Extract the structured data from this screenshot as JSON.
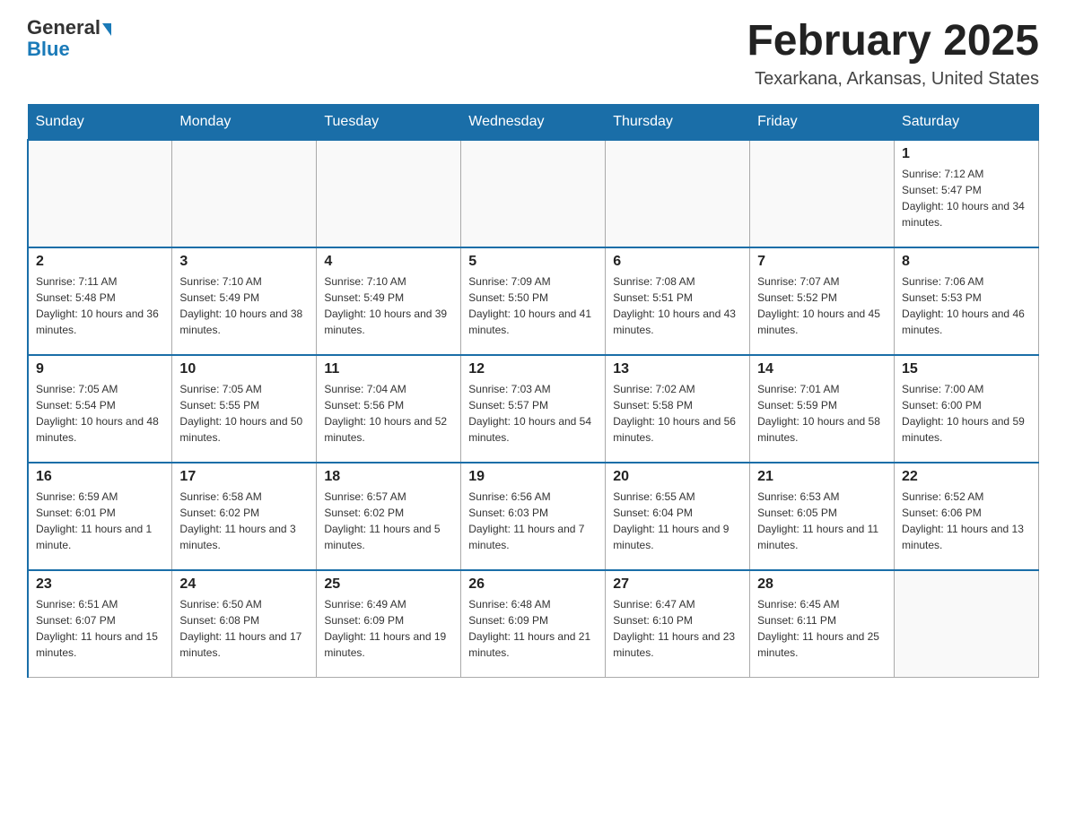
{
  "header": {
    "logo_general": "General",
    "logo_blue": "Blue",
    "month_title": "February 2025",
    "location": "Texarkana, Arkansas, United States"
  },
  "days_of_week": [
    "Sunday",
    "Monday",
    "Tuesday",
    "Wednesday",
    "Thursday",
    "Friday",
    "Saturday"
  ],
  "weeks": [
    [
      {
        "day": "",
        "info": ""
      },
      {
        "day": "",
        "info": ""
      },
      {
        "day": "",
        "info": ""
      },
      {
        "day": "",
        "info": ""
      },
      {
        "day": "",
        "info": ""
      },
      {
        "day": "",
        "info": ""
      },
      {
        "day": "1",
        "info": "Sunrise: 7:12 AM\nSunset: 5:47 PM\nDaylight: 10 hours and 34 minutes."
      }
    ],
    [
      {
        "day": "2",
        "info": "Sunrise: 7:11 AM\nSunset: 5:48 PM\nDaylight: 10 hours and 36 minutes."
      },
      {
        "day": "3",
        "info": "Sunrise: 7:10 AM\nSunset: 5:49 PM\nDaylight: 10 hours and 38 minutes."
      },
      {
        "day": "4",
        "info": "Sunrise: 7:10 AM\nSunset: 5:49 PM\nDaylight: 10 hours and 39 minutes."
      },
      {
        "day": "5",
        "info": "Sunrise: 7:09 AM\nSunset: 5:50 PM\nDaylight: 10 hours and 41 minutes."
      },
      {
        "day": "6",
        "info": "Sunrise: 7:08 AM\nSunset: 5:51 PM\nDaylight: 10 hours and 43 minutes."
      },
      {
        "day": "7",
        "info": "Sunrise: 7:07 AM\nSunset: 5:52 PM\nDaylight: 10 hours and 45 minutes."
      },
      {
        "day": "8",
        "info": "Sunrise: 7:06 AM\nSunset: 5:53 PM\nDaylight: 10 hours and 46 minutes."
      }
    ],
    [
      {
        "day": "9",
        "info": "Sunrise: 7:05 AM\nSunset: 5:54 PM\nDaylight: 10 hours and 48 minutes."
      },
      {
        "day": "10",
        "info": "Sunrise: 7:05 AM\nSunset: 5:55 PM\nDaylight: 10 hours and 50 minutes."
      },
      {
        "day": "11",
        "info": "Sunrise: 7:04 AM\nSunset: 5:56 PM\nDaylight: 10 hours and 52 minutes."
      },
      {
        "day": "12",
        "info": "Sunrise: 7:03 AM\nSunset: 5:57 PM\nDaylight: 10 hours and 54 minutes."
      },
      {
        "day": "13",
        "info": "Sunrise: 7:02 AM\nSunset: 5:58 PM\nDaylight: 10 hours and 56 minutes."
      },
      {
        "day": "14",
        "info": "Sunrise: 7:01 AM\nSunset: 5:59 PM\nDaylight: 10 hours and 58 minutes."
      },
      {
        "day": "15",
        "info": "Sunrise: 7:00 AM\nSunset: 6:00 PM\nDaylight: 10 hours and 59 minutes."
      }
    ],
    [
      {
        "day": "16",
        "info": "Sunrise: 6:59 AM\nSunset: 6:01 PM\nDaylight: 11 hours and 1 minute."
      },
      {
        "day": "17",
        "info": "Sunrise: 6:58 AM\nSunset: 6:02 PM\nDaylight: 11 hours and 3 minutes."
      },
      {
        "day": "18",
        "info": "Sunrise: 6:57 AM\nSunset: 6:02 PM\nDaylight: 11 hours and 5 minutes."
      },
      {
        "day": "19",
        "info": "Sunrise: 6:56 AM\nSunset: 6:03 PM\nDaylight: 11 hours and 7 minutes."
      },
      {
        "day": "20",
        "info": "Sunrise: 6:55 AM\nSunset: 6:04 PM\nDaylight: 11 hours and 9 minutes."
      },
      {
        "day": "21",
        "info": "Sunrise: 6:53 AM\nSunset: 6:05 PM\nDaylight: 11 hours and 11 minutes."
      },
      {
        "day": "22",
        "info": "Sunrise: 6:52 AM\nSunset: 6:06 PM\nDaylight: 11 hours and 13 minutes."
      }
    ],
    [
      {
        "day": "23",
        "info": "Sunrise: 6:51 AM\nSunset: 6:07 PM\nDaylight: 11 hours and 15 minutes."
      },
      {
        "day": "24",
        "info": "Sunrise: 6:50 AM\nSunset: 6:08 PM\nDaylight: 11 hours and 17 minutes."
      },
      {
        "day": "25",
        "info": "Sunrise: 6:49 AM\nSunset: 6:09 PM\nDaylight: 11 hours and 19 minutes."
      },
      {
        "day": "26",
        "info": "Sunrise: 6:48 AM\nSunset: 6:09 PM\nDaylight: 11 hours and 21 minutes."
      },
      {
        "day": "27",
        "info": "Sunrise: 6:47 AM\nSunset: 6:10 PM\nDaylight: 11 hours and 23 minutes."
      },
      {
        "day": "28",
        "info": "Sunrise: 6:45 AM\nSunset: 6:11 PM\nDaylight: 11 hours and 25 minutes."
      },
      {
        "day": "",
        "info": ""
      }
    ]
  ]
}
